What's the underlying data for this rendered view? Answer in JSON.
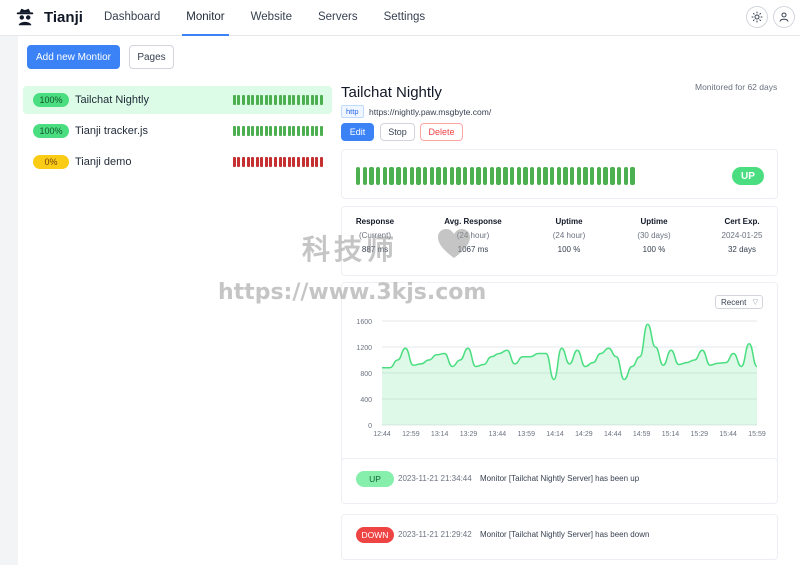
{
  "app": {
    "name": "Tianji"
  },
  "nav": [
    {
      "label": "Dashboard",
      "active": false
    },
    {
      "label": "Monitor",
      "active": true
    },
    {
      "label": "Website",
      "active": false
    },
    {
      "label": "Servers",
      "active": false
    },
    {
      "label": "Settings",
      "active": false
    }
  ],
  "header_icons": {
    "theme": "sun-icon",
    "user": "user-icon"
  },
  "toolbar": {
    "add_label": "Add new Montior",
    "pages_label": "Pages"
  },
  "monitors": [
    {
      "percent": "100%",
      "name": "Tailchat Nightly",
      "status": "up",
      "selected": true
    },
    {
      "percent": "100%",
      "name": "Tianji tracker.js",
      "status": "up",
      "selected": false
    },
    {
      "percent": "0%",
      "name": "Tianji demo",
      "status": "down",
      "selected": false
    }
  ],
  "detail": {
    "title": "Tailchat Nightly",
    "monitored_for": "Monitored for 62 days",
    "type_tag": "http",
    "url": "https://nightly.paw.msgbyte.com/",
    "edit_label": "Edit",
    "stop_label": "Stop",
    "delete_label": "Delete",
    "status_badge": "UP"
  },
  "stats": [
    {
      "header": "Response",
      "sub": "(Current)",
      "value": "887 ms"
    },
    {
      "header": "Avg. Response",
      "sub": "(24 hour)",
      "value": "1067 ms"
    },
    {
      "header": "Uptime",
      "sub": "(24 hour)",
      "value": "100 %"
    },
    {
      "header": "Uptime",
      "sub": "(30 days)",
      "value": "100 %"
    },
    {
      "header": "Cert Exp.",
      "sub": "2024-01-25",
      "value": "32 days"
    }
  ],
  "chart_data": {
    "type": "area",
    "range_select": "Recent",
    "ylim": [
      0,
      1600
    ],
    "y_ticks": [
      0,
      400,
      800,
      1200,
      1600
    ],
    "x_ticks": [
      "12:44",
      "12:59",
      "13:14",
      "13:29",
      "13:44",
      "13:59",
      "14:14",
      "14:29",
      "14:44",
      "14:59",
      "15:14",
      "15:29",
      "15:44",
      "15:59"
    ],
    "color": "#4ade80",
    "values": [
      880,
      880,
      1000,
      1180,
      920,
      940,
      1000,
      1080,
      1100,
      900,
      1000,
      1180,
      900,
      930,
      1050,
      1100,
      1150,
      940,
      1050,
      1050,
      1100,
      1100,
      700,
      1180,
      940,
      1150,
      900,
      960,
      1100,
      1180,
      1050,
      700,
      900,
      1050,
      1550,
      1200,
      920,
      1150,
      930,
      960,
      1000,
      1150,
      920,
      950,
      960,
      1100,
      900,
      1250,
      900
    ]
  },
  "events": [
    {
      "status": "UP",
      "time": "2023-11-21 21:34:44",
      "message": "Monitor [Tailchat Nightly Server] has been up"
    },
    {
      "status": "DOWN",
      "time": "2023-11-21 21:29:42",
      "message": "Monitor [Tailchat Nightly Server] has been down"
    }
  ],
  "watermark": {
    "title": "科技师",
    "url": "https://www.3kjs.com"
  },
  "colors": {
    "primary": "#3b82f6",
    "up": "#4ade80",
    "down": "#ef4444",
    "bar_up": "#4caf50",
    "bar_down": "#c53030"
  }
}
